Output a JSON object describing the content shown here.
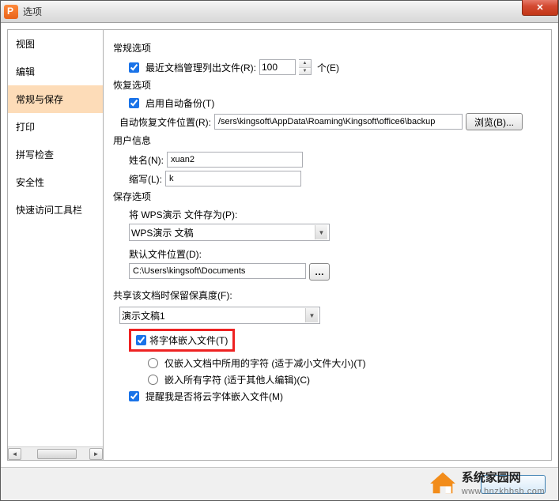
{
  "window": {
    "title": "选项"
  },
  "sidebar": {
    "items": [
      {
        "label": "视图"
      },
      {
        "label": "编辑"
      },
      {
        "label": "常规与保存"
      },
      {
        "label": "打印"
      },
      {
        "label": "拼写检查"
      },
      {
        "label": "安全性"
      },
      {
        "label": "快速访问工具栏"
      }
    ],
    "selected_index": 2
  },
  "general": {
    "section_title": "常规选项",
    "recent_label": "最近文档管理列出文件(R):",
    "recent_count": "100",
    "recent_unit": "个(E)"
  },
  "recovery": {
    "section_title": "恢复选项",
    "auto_backup_label": "启用自动备份(T)",
    "path_label": "自动恢复文件位置(R):",
    "path_value": "/sers\\kingsoft\\AppData\\Roaming\\Kingsoft\\office6\\backup",
    "browse_btn": "浏览(B)..."
  },
  "user": {
    "section_title": "用户信息",
    "name_label": "姓名(N):",
    "name_value": "xuan2",
    "initials_label": "缩写(L):",
    "initials_value": "k"
  },
  "save": {
    "section_title": "保存选项",
    "save_as_label": "将 WPS演示 文件存为(P):",
    "save_as_value": "WPS演示 文稿",
    "default_loc_label": "默认文件位置(D):",
    "default_loc_value": "C:\\Users\\kingsoft\\Documents"
  },
  "share": {
    "section_title": "共享该文档时保留保真度(F):",
    "doc_value": "演示文稿1",
    "embed_fonts_label": "将字体嵌入文件(T)",
    "embed_used_label": "仅嵌入文档中所用的字符 (适于减小文件大小)(T)",
    "embed_all_label": "嵌入所有字符 (适于其他人编辑)(C)",
    "remind_cloud_label": "提醒我是否将云字体嵌入文件(M)"
  },
  "watermark": {
    "title": "系统家园网",
    "url": "www.hnzkhbsb.com"
  }
}
